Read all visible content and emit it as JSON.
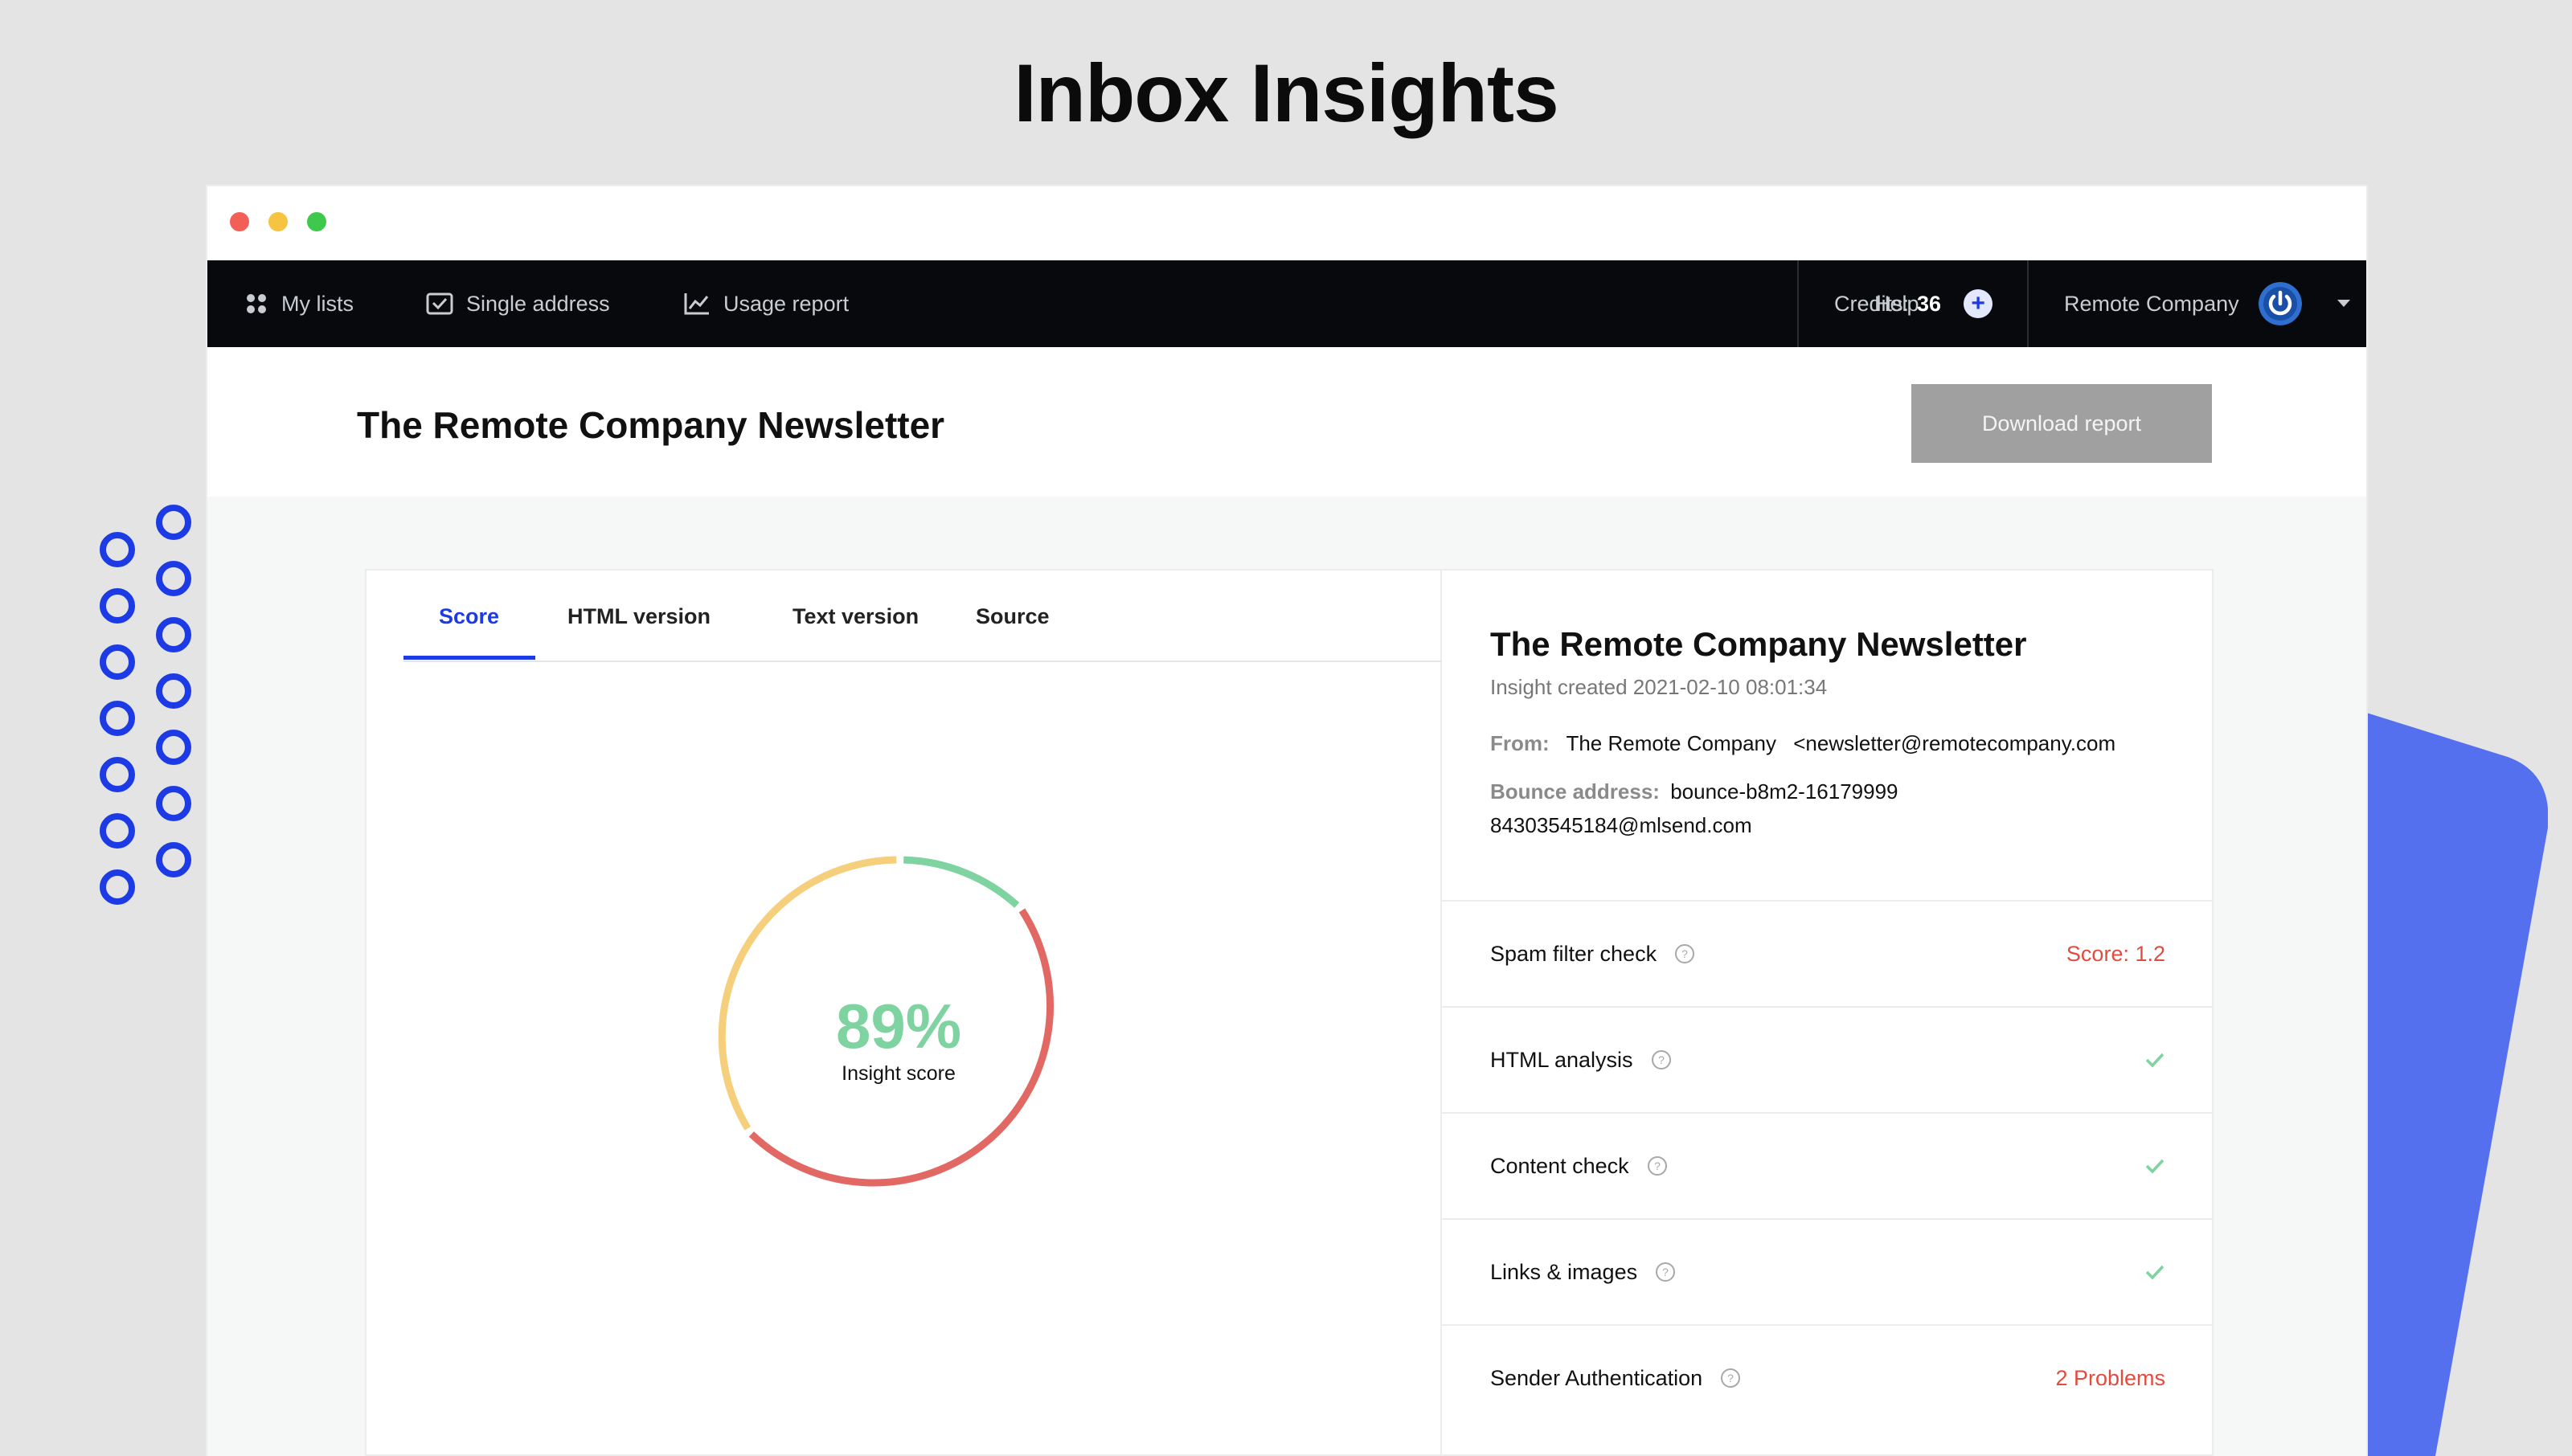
{
  "page_heading": "Inbox Insights",
  "colors": {
    "accent": "#1d3be5",
    "score_green": "#7ed3a0",
    "score_yellow": "#f6cf7c",
    "score_red": "#e26863",
    "problem_red": "#e04c3f",
    "decor_blue": "#5570ef"
  },
  "nav": {
    "left": [
      {
        "label": "My lists",
        "icon": "grid-dots-icon"
      },
      {
        "label": "Single address",
        "icon": "envelope-check-icon"
      },
      {
        "label": "Usage report",
        "icon": "line-chart-icon"
      }
    ],
    "help_label": "Help",
    "credits_label": "Credits:",
    "credits_value": "36",
    "add_credits_symbol": "+",
    "account_name": "Remote Company",
    "account_icon": "power-avatar-icon",
    "dropdown_icon": "caret-down-icon"
  },
  "header": {
    "title": "The Remote Company Newsletter",
    "download_label": "Download report"
  },
  "tabs": [
    {
      "label": "Score",
      "active": true
    },
    {
      "label": "HTML version",
      "active": false
    },
    {
      "label": "Text version",
      "active": false
    },
    {
      "label": "Source",
      "active": false
    }
  ],
  "score": {
    "value_text": "89%",
    "label": "Insight score"
  },
  "report": {
    "title": "The Remote Company Newsletter",
    "created": "Insight created 2021-02-10 08:01:34",
    "from_label": "From:",
    "from_name": "The Remote Company",
    "from_email": "<newsletter@remotecompany.com",
    "bounce_label": "Bounce address:",
    "bounce_value": "bounce-b8m2-1617999984303545184@mlsend.com"
  },
  "checks": [
    {
      "label": "Spam filter check",
      "status_text": "Score: 1.2",
      "status": "problem"
    },
    {
      "label": "HTML analysis",
      "status_text": "",
      "status": "ok"
    },
    {
      "label": "Content check",
      "status_text": "",
      "status": "ok"
    },
    {
      "label": "Links & images",
      "status_text": "",
      "status": "ok"
    },
    {
      "label": "Sender Authentication",
      "status_text": "2 Problems",
      "status": "problem"
    }
  ]
}
